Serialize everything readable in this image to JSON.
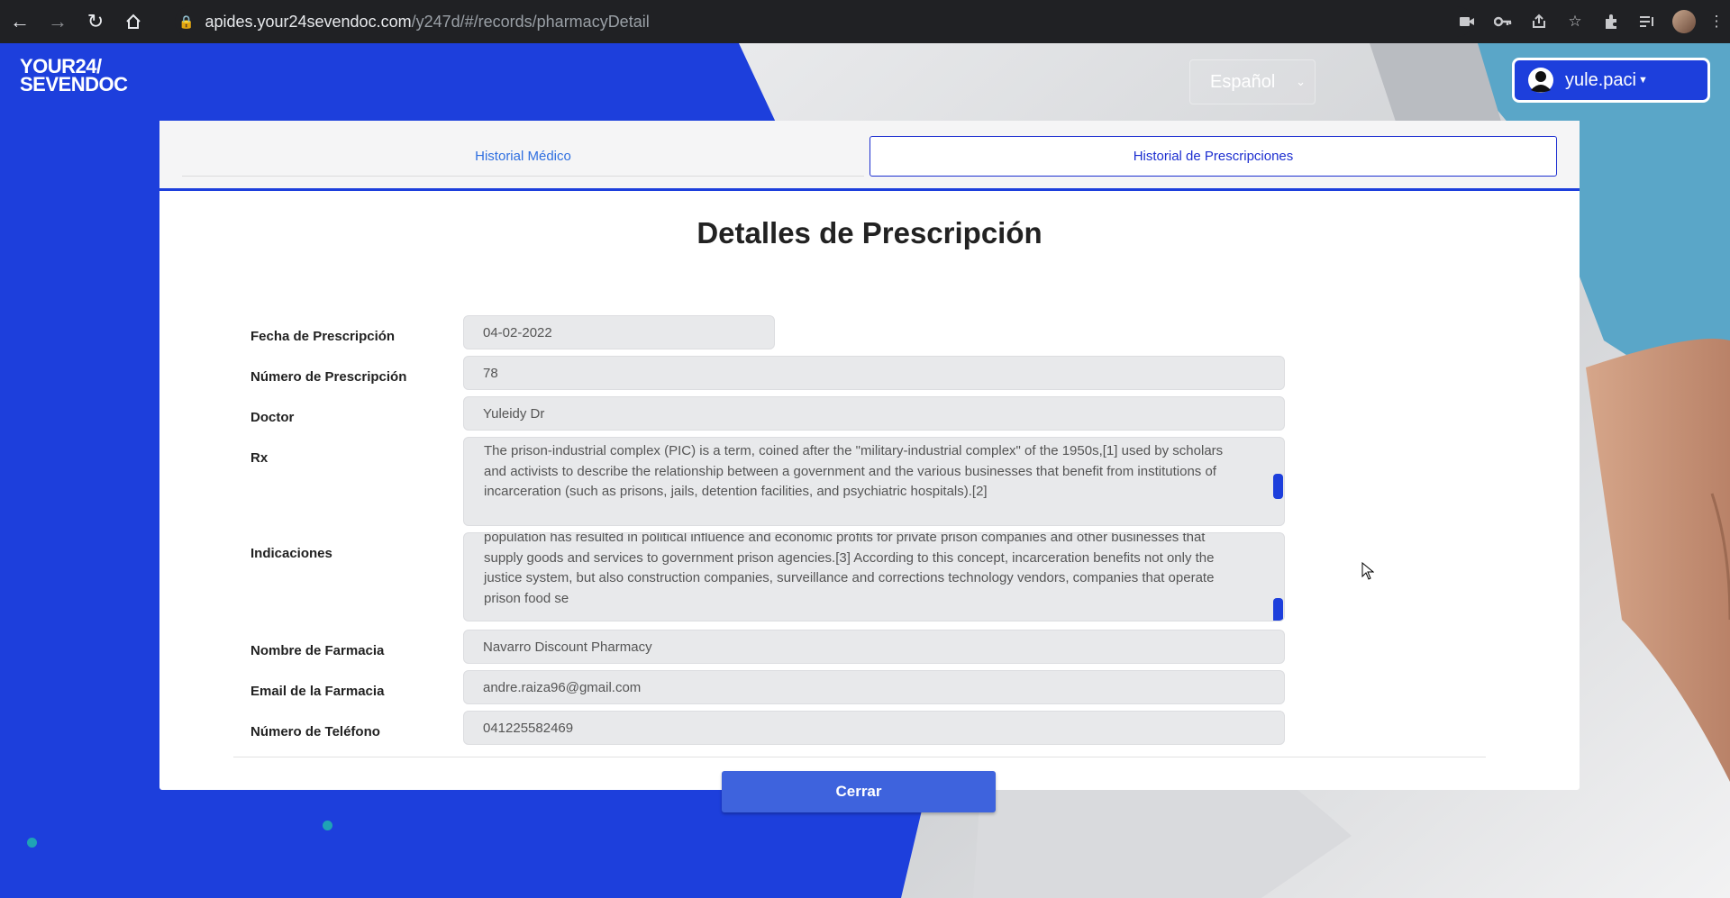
{
  "browser": {
    "url_host": "apides.your24sevendoc.com",
    "url_path": "/y247d/#/records/pharmacyDetail"
  },
  "header": {
    "logo_line1": "YOUR24/",
    "logo_line2": "SEVENDOC",
    "language": "Español",
    "user": "yule.paci"
  },
  "tabs": [
    {
      "label": "Historial Médico"
    },
    {
      "label": "Historial de Prescripciones"
    }
  ],
  "detail": {
    "title": "Detalles de Prescripción",
    "fields": {
      "fecha": {
        "label": "Fecha de Prescripción",
        "value": "04-02-2022"
      },
      "numero": {
        "label": "Número de Prescripción",
        "value": "78"
      },
      "doctor": {
        "label": "Doctor",
        "value": "Yuleidy Dr"
      },
      "rx": {
        "label": "Rx",
        "value": "The prison-industrial complex (PIC) is a term, coined after the \"military-industrial complex\" of the 1950s,[1] used by scholars and activists to describe the relationship between a government and the various businesses that benefit from institutions of incarceration (such as prisons, jails, detention facilities, and psychiatric hospitals).[2]"
      },
      "indicaciones": {
        "label": "Indicaciones",
        "value": "population has resulted in political influence and economic profits for private prison companies and other businesses that supply goods and services to government prison agencies.[3] According to this concept, incarceration benefits not only the justice system, but also construction companies, surveillance and corrections technology vendors, companies that operate prison food se"
      },
      "farmacia": {
        "label": "Nombre de Farmacia",
        "value": "Navarro Discount Pharmacy"
      },
      "email": {
        "label": "Email de la Farmacia",
        "value": "andre.raiza96@gmail.com"
      },
      "telefono": {
        "label": "Número de Teléfono",
        "value": "041225582469"
      }
    },
    "close_label": "Cerrar"
  },
  "colors": {
    "brand_blue": "#1d3fdc",
    "button_blue": "#3e63dd"
  }
}
